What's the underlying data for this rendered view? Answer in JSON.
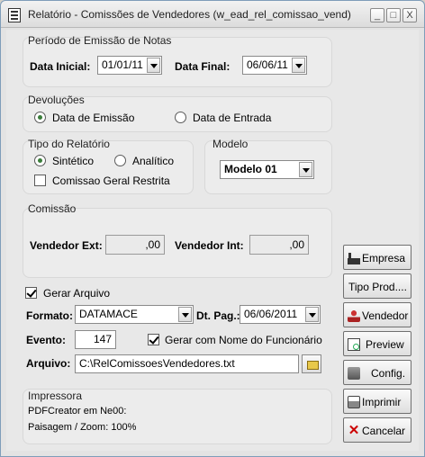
{
  "window": {
    "title": "Relatório - Comissões de Vendedores (w_ead_rel_comissao_vend)",
    "minimize_glyph": "_",
    "maximize_glyph": "□",
    "close_glyph": "X"
  },
  "periodo": {
    "title": "Período de Emissão de Notas",
    "data_inicial_label": "Data Inicial:",
    "data_inicial_value": "01/01/11",
    "data_final_label": "Data Final:",
    "data_final_value": "06/06/11"
  },
  "devolucoes": {
    "title": "Devoluções",
    "option_emissao": "Data de Emissão",
    "option_entrada": "Data de Entrada",
    "selected": "Data de Emissão"
  },
  "tipo_relatorio": {
    "title": "Tipo do Relatório",
    "option_sintetico": "Sintético",
    "option_analitico": "Analítico",
    "selected": "Sintético",
    "comissao_geral_label": "Comissao Geral Restrita",
    "comissao_geral_checked": false
  },
  "modelo": {
    "title": "Modelo",
    "value": "Modelo 01"
  },
  "comissao": {
    "title": "Comissão",
    "vendedor_ext_label": "Vendedor Ext:",
    "vendedor_ext_value": ",00",
    "vendedor_int_label": "Vendedor Int:",
    "vendedor_int_value": ",00"
  },
  "arquivo": {
    "gerar_label": "Gerar Arquivo",
    "gerar_checked": true,
    "formato_label": "Formato:",
    "formato_value": "DATAMACE",
    "dt_pag_label": "Dt. Pag.:",
    "dt_pag_value": "06/06/2011",
    "evento_label": "Evento:",
    "evento_value": "147",
    "gerar_nome_label": "Gerar com Nome do Funcionário",
    "gerar_nome_checked": true,
    "arquivo_label": "Arquivo:",
    "arquivo_value": "C:\\RelComissoesVendedores.txt"
  },
  "impressora": {
    "title": "Impressora",
    "line1": "PDFCreator em Ne00:",
    "line2": "Paisagem / Zoom: 100%"
  },
  "buttons": {
    "empresa": "Empresa",
    "tipo_prod": "Tipo Prod....",
    "vendedor": "Vendedor",
    "preview": "Preview",
    "config": "Config.",
    "imprimir": "Imprimir",
    "cancelar": "Cancelar"
  },
  "colors": {
    "radio_selected": "#3a7d3a",
    "cancel_icon": "#cc0000"
  }
}
